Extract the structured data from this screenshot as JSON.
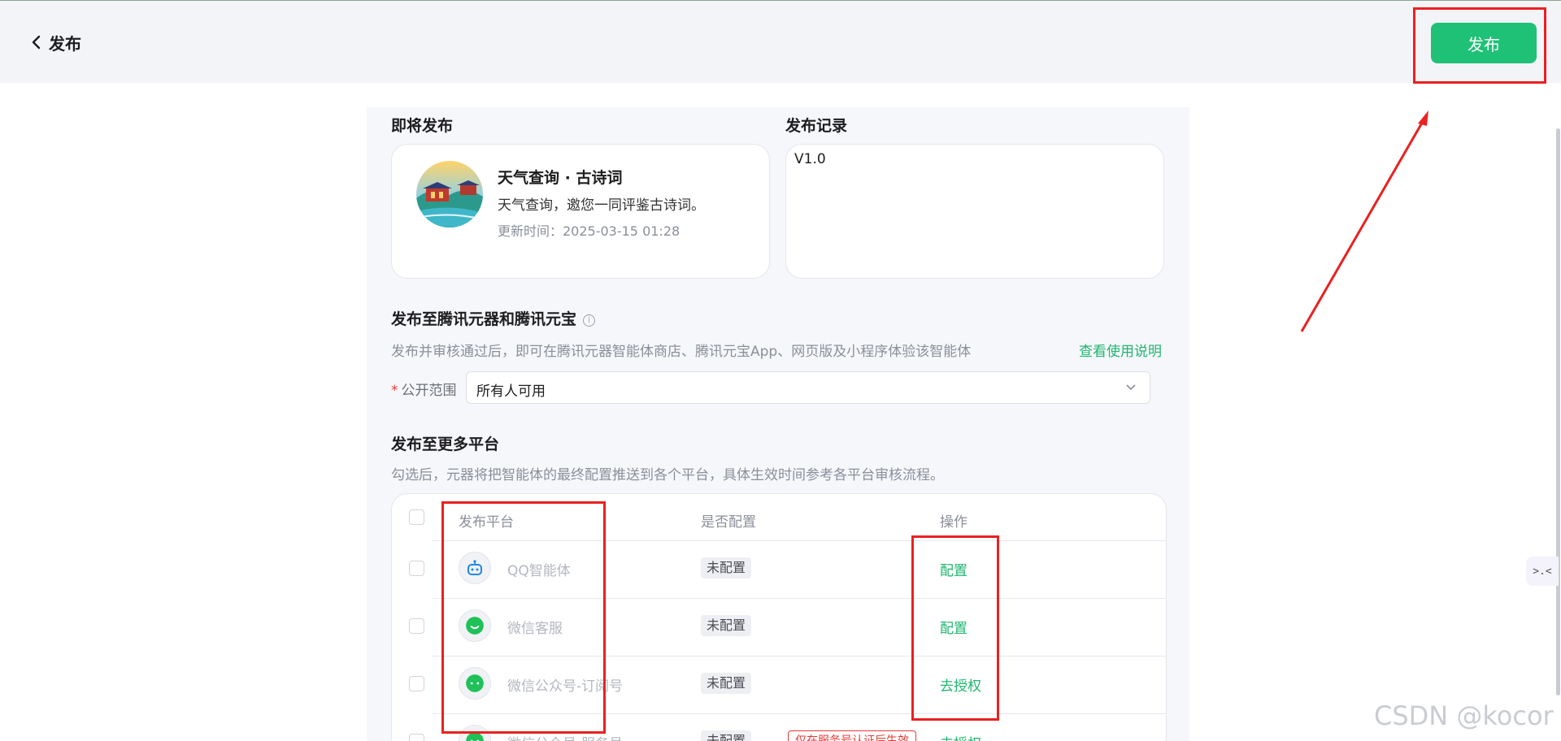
{
  "header": {
    "back_label": "发布",
    "publish_button": "发布"
  },
  "upcoming": {
    "title": "即将发布",
    "agent_name": "天气查询 · 古诗词",
    "agent_desc": "天气查询，邀您一同评鉴古诗词。",
    "update_time": "更新时间：2025-03-15 01:28"
  },
  "history": {
    "title": "发布记录",
    "version": "V1.0"
  },
  "yuanqi": {
    "title": "发布至腾讯元器和腾讯元宝",
    "description": "发布并审核通过后，即可在腾讯元器智能体商店、腾讯元宝App、网页版及小程序体验该智能体",
    "help_link": "查看使用说明",
    "scope_label": "公开范围",
    "required_mark": "*",
    "scope_value": "所有人可用"
  },
  "more": {
    "title": "发布至更多平台",
    "description": "勾选后，元器将把智能体的最终配置推送到各个平台，具体生效时间参考各平台审核流程。",
    "columns": {
      "platform": "发布平台",
      "configured": "是否配置",
      "action": "操作"
    },
    "rows": [
      {
        "name": "QQ智能体",
        "status": "未配置",
        "action": "配置",
        "icon": "qq-robot-icon"
      },
      {
        "name": "微信客服",
        "status": "未配置",
        "action": "配置",
        "icon": "wechat-service-icon"
      },
      {
        "name": "微信公众号-订阅号",
        "status": "未配置",
        "action": "去授权",
        "icon": "wechat-chat-icon"
      },
      {
        "name": "微信公众号-服务号",
        "status": "未配置",
        "action": "去授权",
        "icon": "wechat-chat-icon",
        "note": "仅在服务号认证后生效"
      }
    ]
  },
  "float_button_label": ">.<",
  "watermark": "CSDN @kocor",
  "colors": {
    "brand_green": "#1fc177",
    "link_green": "#1fb66f",
    "highlight_red": "#ea2121"
  }
}
